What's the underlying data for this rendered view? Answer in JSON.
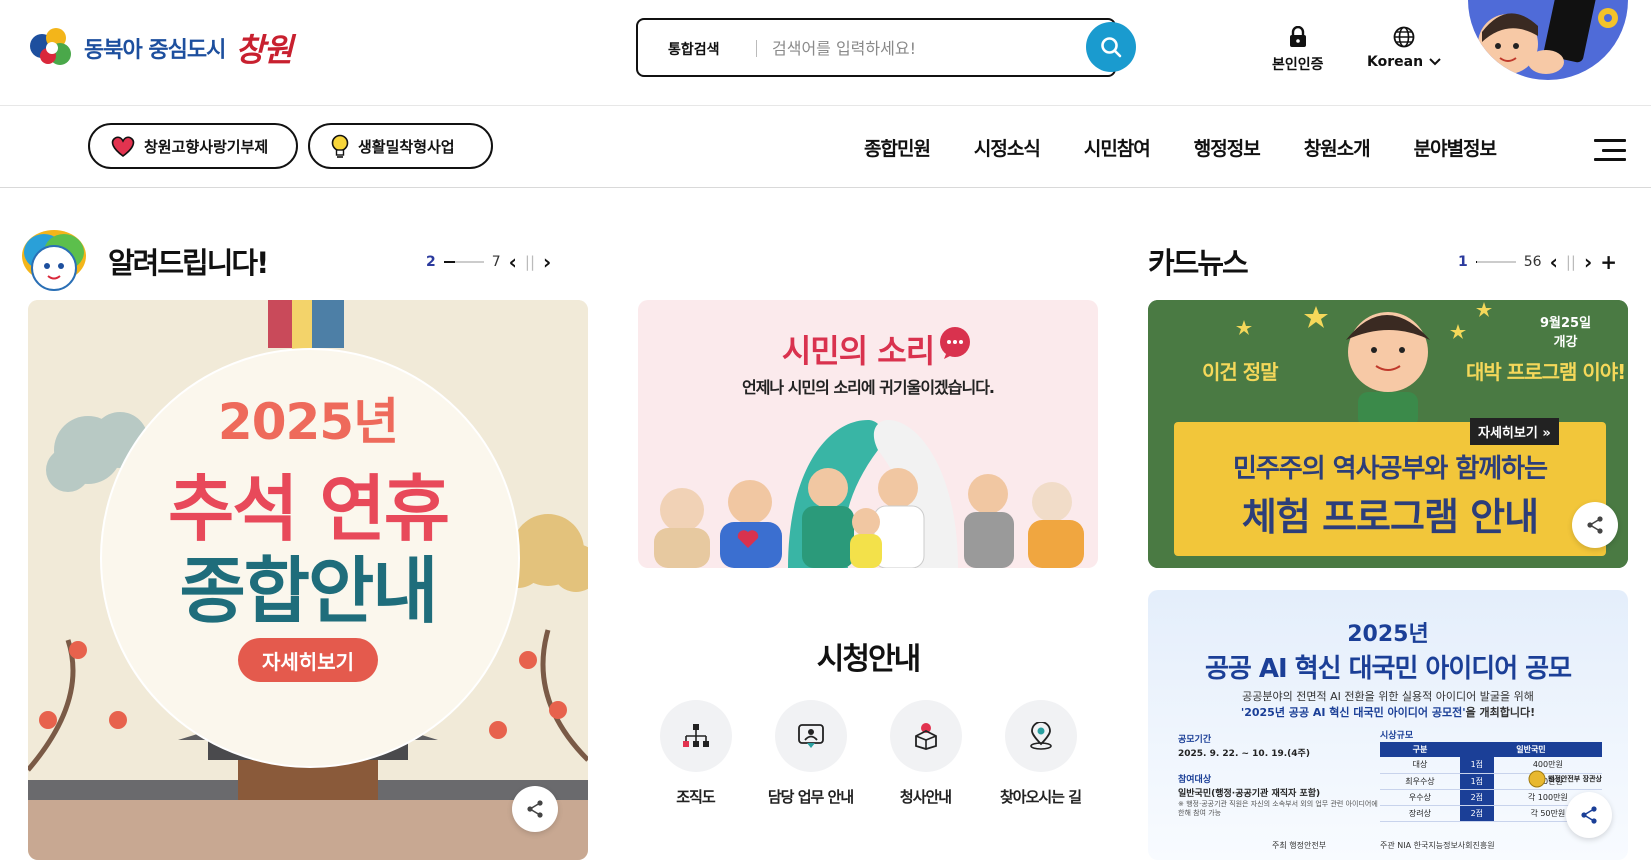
{
  "header": {
    "logo_sub": "동북아 중심도시",
    "logo_main": "창원",
    "search": {
      "scope": "통합검색",
      "placeholder": "검색어를 입력하세요!"
    },
    "cert_label": "본인인증",
    "lang_label": "Korean"
  },
  "quick_links": [
    "창원고향사랑기부제",
    "생활밀착형사업"
  ],
  "nav": [
    "종합민원",
    "시정소식",
    "시민참여",
    "행정정보",
    "창원소개",
    "분야별정보"
  ],
  "notice": {
    "title": "알려드립니다!",
    "pager": {
      "current": "2",
      "total": "7",
      "progress": 0.29
    },
    "banner": {
      "year": "2025년",
      "line1": "추석 연휴",
      "line2": "종합안내",
      "button": "자세히보기"
    }
  },
  "voice": {
    "title": "시민의 소리",
    "subtitle": "언제나 시민의 소리에 귀기울이겠습니다."
  },
  "city_hall": {
    "title": "시청안내",
    "items": [
      {
        "label": "조직도",
        "icon": "org-chart-icon"
      },
      {
        "label": "담당 업무 안내",
        "icon": "staff-guide-icon"
      },
      {
        "label": "청사안내",
        "icon": "building-guide-icon"
      },
      {
        "label": "찾아오시는 길",
        "icon": "location-pin-icon"
      }
    ]
  },
  "card_news": {
    "title": "카드뉴스",
    "pager": {
      "current": "1",
      "total": "56",
      "progress": 0.02
    },
    "program": {
      "date": "9월25일",
      "date_sub": "개강",
      "left": "이건 정말",
      "right": "대박 프로그램 이야!",
      "more": "자세히보기 »",
      "line1": "민주주의 역사공부와 함께하는",
      "line2": "체험 프로그램 안내"
    },
    "ai": {
      "year": "2025년",
      "title": "공공 AI 혁신 대국민 아이디어 공모",
      "desc1": "공공분야의 전면적 AI 전환을 위한 실용적 아이디어 발굴을 위해",
      "desc2_em": "'2025년 공공 AI 혁신 대국민 아이디어 공모전'",
      "desc2_tail": "을 개최합니다!",
      "period_label": "공모기간",
      "period": "2025. 9. 22. ~ 10. 19.(4주)",
      "target_label": "참여대상",
      "target": "일반국민(행정·공공기관 재직자 포함)",
      "note": "※ 행정·공공기관 직원은 자신의 소속부서 외의 업무 관련 아이디어에 한해 참여 가능",
      "prize_label": "시상규모",
      "table_headers": [
        "구분",
        "일반국민"
      ],
      "table_rows": [
        [
          "대상",
          "1점",
          "400만원"
        ],
        [
          "최우수상",
          "1점",
          "300만원"
        ],
        [
          "우수상",
          "2점",
          "각 100만원"
        ],
        [
          "장려상",
          "2점",
          "각 50만원"
        ]
      ],
      "award_note": "행정안전부 장관상",
      "host_label": "주최",
      "host": "행정안전부",
      "org_label": "주관",
      "org": "NIA 한국지능정보사회진흥원"
    }
  },
  "colors": {
    "accent": "#1a9bcf",
    "brand_red": "#c8202f",
    "brand_blue": "#1d4f9e"
  }
}
